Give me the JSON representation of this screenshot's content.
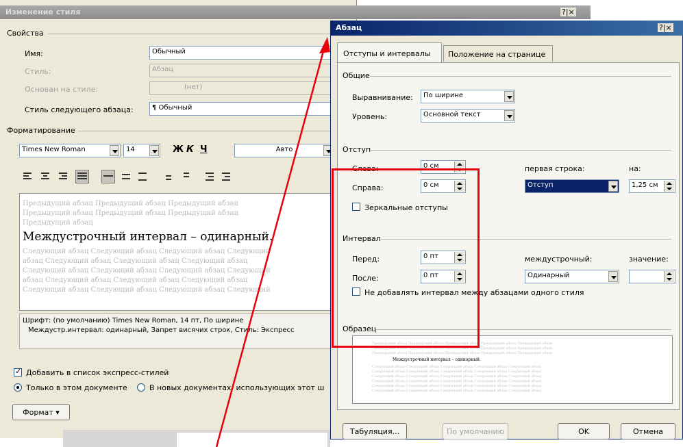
{
  "style_dialog": {
    "title": "Изменение стиля",
    "help_close": "?|×",
    "properties_label": "Свойства",
    "name_label": "Имя:",
    "name_value": "Обычный",
    "type_label": "Стиль:",
    "type_value": "Абзац",
    "based_on_label": "Основан на стиле:",
    "based_on_value": "(нет)",
    "next_style_label": "Стиль следующего абзаца:",
    "next_style_value": "¶ Обычный",
    "formatting_label": "Форматирование",
    "font_value": "Times New Roman",
    "size_value": "14",
    "bold": "Ж",
    "italic": "К",
    "underline": "Ч",
    "color_value": "Авто",
    "preview_prev_1": "Предыдущий абзац Предыдущий абзац Предыдущий абзац",
    "preview_prev_2": "Предыдущий абзац Предыдущий абзац Предыдущий абзац",
    "preview_prev_3": "Предыдущий абзац",
    "preview_main": "Междустрочный интервал – одинарный.",
    "preview_next_1": "Следующий абзац Следующий абзац Следующий абзац Следующий",
    "preview_next_2": "абзац Следующий абзац Следующий абзац Следующий абзац",
    "preview_next_3": "Следующий абзац Следующий абзац Следующий абзац Следующий",
    "preview_next_4": "абзац Следующий абзац Следующий абзац Следующий абзац",
    "preview_next_5": "Следующий абзац Следующий абзац Следующий абзац Следующий",
    "desc_line_1": "Шрифт: (по умолчанию) Times New Roman, 14 пт, По ширине",
    "desc_line_2": "Междустр.интервал: одинарный, Запрет висячих строк, Стиль: Экспресс",
    "add_to_quick_label": "Добавить в список экспресс-стилей",
    "only_this_doc_label": "Только в этом документе",
    "new_docs_label": "В новых документах, использующих этот ш",
    "format_button": "Формат ▾"
  },
  "paragraph_dialog": {
    "title": "Абзац",
    "help_close": "?|×",
    "tab_indents": "Отступы и интервалы",
    "tab_position": "Положение на странице",
    "general_label": "Общие",
    "alignment_label": "Выравнивание:",
    "alignment_value": "По ширине",
    "level_label": "Уровень:",
    "level_value": "Основной текст",
    "indent_label": "Отступ",
    "left_label": "Слева:",
    "left_value": "0 см",
    "right_label": "Справа:",
    "right_value": "0 см",
    "first_line_label": "первая строка:",
    "first_line_value": "Отступ",
    "by_label": "на:",
    "by_value": "1,25 см",
    "mirror_label": "Зеркальные отступы",
    "spacing_label": "Интервал",
    "before_label": "Перед:",
    "before_value": "0 пт",
    "after_label": "После:",
    "after_value": "0 пт",
    "line_spacing_label": "междустрочный:",
    "line_spacing_value": "Одинарный",
    "value_label": "значение:",
    "value_value": "",
    "no_space_label": "Не добавлять интервал между абзацами одного стиля",
    "sample_label": "Образец",
    "sample_main": "Междустрочный интервал – одинарный.",
    "sample_filler": "Предыдущий абзац Предыдущий абзац Предыдущий абзац Предыдущий абзац Предыдущий абзац",
    "sample_next": "Следующий абзац Следующий абзац Следующий абзац Следующий абзац Следующий абзац",
    "tabs_button": "Табуляция...",
    "default_button": "По умолчанию",
    "ok_button": "OK",
    "cancel_button": "Отмена"
  },
  "colors": {
    "title_active": "#0a246a",
    "highlight_box": "#e8000d",
    "arrow": "#e8000d",
    "dialog_bg": "#ece9d8"
  }
}
